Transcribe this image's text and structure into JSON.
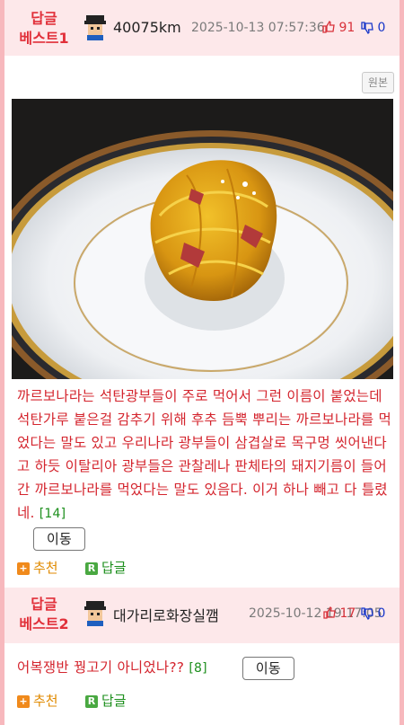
{
  "replies": [
    {
      "rank_line1": "답글",
      "rank_line2": "베스트1",
      "nickname": "40075km",
      "date": "2025-10-13 07:57:36",
      "upvotes": "91",
      "downvotes": "0",
      "original_label": "원본",
      "text": "까르보나라는 석탄광부들이 주로 먹어서 그런 이름이 붙었는데 석탄가루 붙은걸 감추기 위해 후추 듬뿍 뿌리는 까르보나라를 먹었다는 말도 있고 우리나라 광부들이 삼겹살로 목구멍 씻어낸다고 하듯 이탈리아 광부들은 관찰레나 판체타의 돼지기름이 들어간 까르보나라를 먹었다는 말도 있음다. 이거 하나 빼고 다 틀렸네.",
      "reply_count": "[14]",
      "move_label": "이동",
      "recommend_label": "추천",
      "reply_label": "답글"
    },
    {
      "rank_line1": "답글",
      "rank_line2": "베스트2",
      "nickname": "대가리로화장실깸",
      "date": "2025-10-12 19:17:05",
      "upvotes": "17",
      "downvotes": "0",
      "text": "어복쟁반 꿩고기 아니었나??",
      "reply_count": "[8]",
      "move_label": "이동",
      "recommend_label": "추천",
      "reply_label": "답글"
    }
  ],
  "badges": {
    "recommend": "+",
    "reply": "R"
  },
  "colors": {
    "accent": "#e1303a",
    "header_bg": "#fde8ea",
    "border": "#f7b8bd"
  }
}
